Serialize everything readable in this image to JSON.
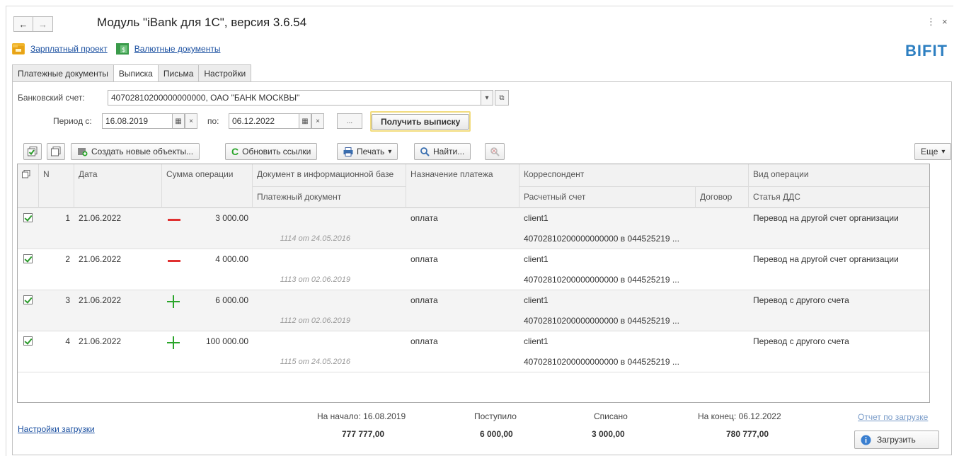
{
  "window": {
    "title": "Модуль \"iBank для 1С\", версия 3.6.54",
    "back_icon": "←",
    "forward_icon": "→",
    "menu_icon": "⋮",
    "close_icon": "×"
  },
  "links": {
    "salary_project": "Зарплатный проект",
    "currency_docs": "Валютные документы"
  },
  "brand": "BIFIT",
  "tabs": [
    {
      "label": "Платежные документы",
      "active": false
    },
    {
      "label": "Выписка",
      "active": true
    },
    {
      "label": "Письма",
      "active": false
    },
    {
      "label": "Настройки",
      "active": false
    }
  ],
  "form": {
    "account_label": "Банковский счет:",
    "account_value": "40702810200000000000, ОАО \"БАНК МОСКВЫ\"",
    "period_label": "Период с:",
    "period_from": "16.08.2019",
    "to_label": "по:",
    "period_to": "06.12.2022",
    "ellipsis": "...",
    "get_statement": "Получить выписку"
  },
  "toolbar": {
    "create_new": "Создать новые объекты...",
    "refresh_links": "Обновить ссылки",
    "print": "Печать",
    "find": "Найти...",
    "more": "Еще"
  },
  "grid": {
    "headers": {
      "n": "N",
      "date": "Дата",
      "amount": "Сумма операции",
      "doc_in_base": "Документ в информационной базе",
      "payment_doc": "Платежный документ",
      "purpose": "Назначение платежа",
      "correspondent": "Корреспондент",
      "account": "Расчетный счет",
      "contract": "Договор",
      "op_type": "Вид операции",
      "dds_item": "Статья ДДС"
    },
    "rows": [
      {
        "n": "1",
        "date": "21.06.2022",
        "sign": "minus",
        "amount": "3 000.00",
        "doc": "1114 от 24.05.2016",
        "purpose": "оплата",
        "correspondent": "client1",
        "account": "40702810200000000000 в 044525219 ...",
        "op_type": "Перевод на другой счет организации"
      },
      {
        "n": "2",
        "date": "21.06.2022",
        "sign": "minus",
        "amount": "4 000.00",
        "doc": "1113 от 02.06.2019",
        "purpose": "оплата",
        "correspondent": "client1",
        "account": "40702810200000000000 в 044525219 ...",
        "op_type": "Перевод на другой счет организации"
      },
      {
        "n": "3",
        "date": "21.06.2022",
        "sign": "plus",
        "amount": "6 000.00",
        "doc": "1112 от 02.06.2019",
        "purpose": "оплата",
        "correspondent": "client1",
        "account": "40702810200000000000 в 044525219 ...",
        "op_type": "Перевод с другого счета"
      },
      {
        "n": "4",
        "date": "21.06.2022",
        "sign": "plus",
        "amount": "100 000.00",
        "doc": "1115 от 24.05.2016",
        "purpose": "оплата",
        "correspondent": "client1",
        "account": "40702810200000000000 в 044525219 ...",
        "op_type": "Перевод с другого счета"
      }
    ]
  },
  "footer": {
    "settings_link": "Настройки загрузки",
    "start_label": "На начало: 16.08.2019",
    "start_value": "777 777,00",
    "received_label": "Поступило",
    "received_value": "6 000,00",
    "spent_label": "Списано",
    "spent_value": "3 000,00",
    "end_label": "На конец: 06.12.2022",
    "end_value": "780 777,00",
    "report_link": "Отчет по загрузке",
    "load_button": "Загрузить"
  },
  "colors": {
    "link": "#1a4fa0",
    "brand": "#2d7fc1",
    "minus": "#e03030",
    "plus": "#2aa52a",
    "highlight": "#f2dc7e"
  }
}
